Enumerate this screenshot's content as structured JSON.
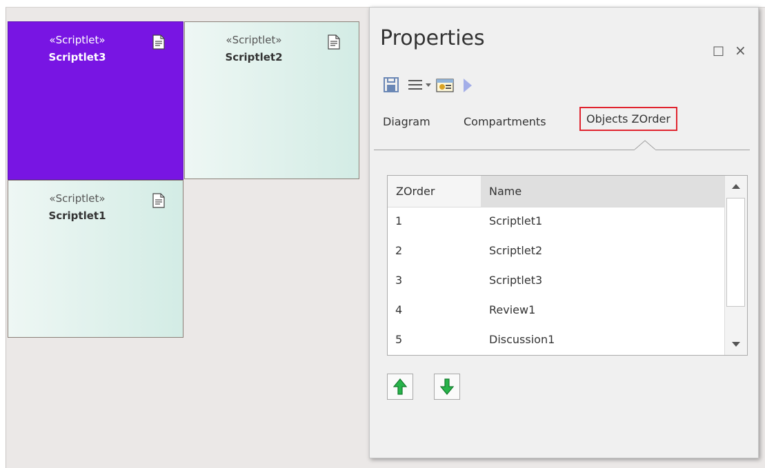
{
  "diagram": {
    "elements": [
      {
        "stereotype": "«Scriptlet»",
        "name": "Scriptlet3",
        "style": "selected-purple"
      },
      {
        "stereotype": "«Scriptlet»",
        "name": "Scriptlet2",
        "style": "teal"
      },
      {
        "stereotype": "«Scriptlet»",
        "name": "Scriptlet1",
        "style": "teal"
      }
    ],
    "colors": {
      "canvas": "#ebe8e7",
      "selected": "#7815e3",
      "element_fill": "#d3ece5"
    }
  },
  "properties": {
    "title": "Properties",
    "window_buttons": {
      "maximize": "□",
      "close": "×"
    },
    "toolbar": {
      "icons": [
        "save-icon",
        "menu-icon",
        "dropdown-arrow-icon",
        "properties-icon",
        "forward-arrow-icon"
      ]
    },
    "tabs": [
      {
        "label": "Diagram"
      },
      {
        "label": "Compartments"
      },
      {
        "label": "Objects ZOrder",
        "active": true
      }
    ],
    "zorder_table": {
      "columns": [
        "ZOrder",
        "Name"
      ],
      "rows": [
        {
          "zorder": "1",
          "name": "Scriptlet1"
        },
        {
          "zorder": "2",
          "name": "Scriptlet2"
        },
        {
          "zorder": "3",
          "name": "Scriptlet3"
        },
        {
          "zorder": "4",
          "name": "Review1"
        },
        {
          "zorder": "5",
          "name": "Discussion1"
        }
      ]
    },
    "move_buttons": {
      "up": "move-up-icon",
      "down": "move-down-icon"
    },
    "highlight_color": "#e0232e"
  }
}
